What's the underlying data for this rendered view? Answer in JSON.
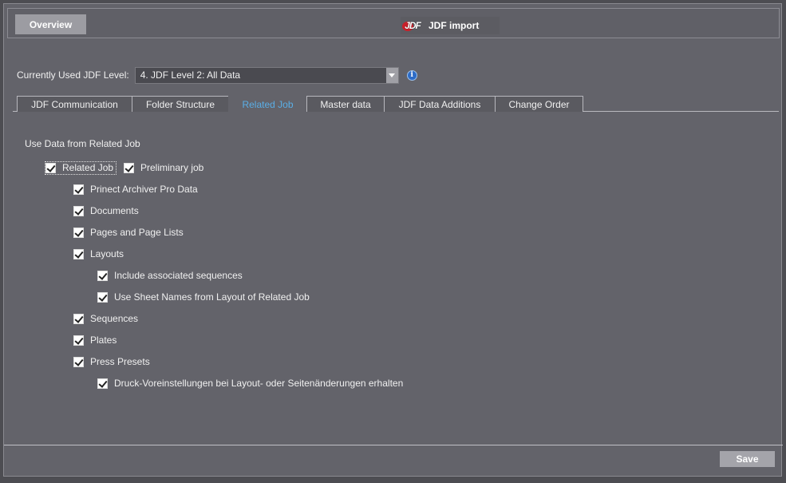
{
  "header": {
    "overview_label": "Overview",
    "logo_text": "JDF",
    "title": "JDF import"
  },
  "level": {
    "label": "Currently Used JDF Level:",
    "value": "4. JDF Level 2: All Data",
    "info_icon": "info-icon"
  },
  "tabs": [
    {
      "label": "JDF Communication",
      "active": false
    },
    {
      "label": "Folder Structure",
      "active": false
    },
    {
      "label": "Related Job",
      "active": true
    },
    {
      "label": "Master data",
      "active": false
    },
    {
      "label": "JDF Data Additions",
      "active": false
    },
    {
      "label": "Change Order",
      "active": false
    }
  ],
  "section_title": "Use Data from Related Job",
  "options": {
    "related_job": {
      "label": "Related Job",
      "checked": true
    },
    "preliminary_job": {
      "label": "Preliminary job",
      "checked": true
    },
    "prinect_archiver": {
      "label": "Prinect Archiver Pro Data",
      "checked": true
    },
    "documents": {
      "label": "Documents",
      "checked": true
    },
    "pages": {
      "label": "Pages and Page Lists",
      "checked": true
    },
    "layouts": {
      "label": "Layouts",
      "checked": true
    },
    "include_sequences": {
      "label": "Include associated sequences",
      "checked": true
    },
    "sheet_names": {
      "label": "Use Sheet Names from Layout of Related Job",
      "checked": true
    },
    "sequences": {
      "label": "Sequences",
      "checked": true
    },
    "plates": {
      "label": "Plates",
      "checked": true
    },
    "press_presets": {
      "label": "Press Presets",
      "checked": true
    },
    "druck": {
      "label": "Druck-Voreinstellungen bei Layout- oder Seitenänderungen erhalten",
      "checked": true
    }
  },
  "footer": {
    "save_label": "Save"
  },
  "colors": {
    "background": "#63636a",
    "active_tab_text": "#5aaee6",
    "button": "#9c9ca2",
    "logo_red": "#c9202a",
    "info_blue": "#2d6cc7"
  }
}
